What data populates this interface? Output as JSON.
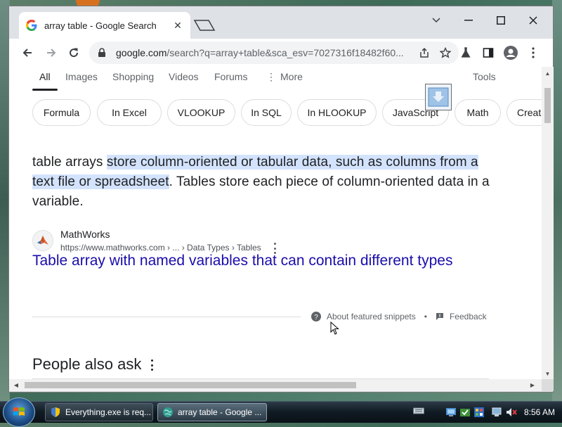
{
  "browser": {
    "tab_title": "array table - Google Search",
    "url_host": "google.com",
    "url_path": "/search?q=array+table&sca_esv=7027316f18482f60..."
  },
  "search_tabs": {
    "all": "All",
    "images": "Images",
    "shopping": "Shopping",
    "videos": "Videos",
    "forums": "Forums",
    "more": "More",
    "tools": "Tools"
  },
  "chips": [
    "Formula",
    "In Excel",
    "VLOOKUP",
    "In SQL",
    "In HLOOKUP",
    "JavaScript",
    "Math",
    "Create"
  ],
  "snippet": {
    "prefix": "table arrays ",
    "highlight": "store column-oriented or tabular data, such as columns from a text file or spreadsheet",
    "suffix": ". Tables store each piece of column-oriented data in a variable."
  },
  "source": {
    "name": "MathWorks",
    "url": "https://www.mathworks.com › ... › Data Types › Tables"
  },
  "result": {
    "title": "Table array with named variables that can contain different types"
  },
  "about": {
    "snippets": "About featured snippets",
    "dot": "•",
    "feedback": "Feedback"
  },
  "paa": {
    "title": "People also ask"
  },
  "taskbar": {
    "items": [
      {
        "label": "Everything.exe is req..."
      },
      {
        "label": "array table - Google ..."
      }
    ],
    "clock": "8:56 AM"
  },
  "colors": {
    "link": "#1a0dab",
    "highlight": "#d3e3fd",
    "text": "#202124"
  }
}
